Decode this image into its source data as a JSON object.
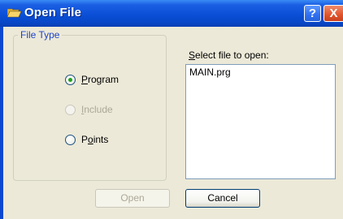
{
  "window": {
    "title": "Open File",
    "help_glyph": "?",
    "close_glyph": "X",
    "title_icon": "open-folder-icon",
    "colors": {
      "titlebar": "#0a4fd6",
      "face": "#ece9d8",
      "accent_text": "#1f44c8"
    }
  },
  "file_type": {
    "group_label": "File Type",
    "options": [
      {
        "label": "Program",
        "selected": true,
        "enabled": true
      },
      {
        "label": "Include",
        "selected": false,
        "enabled": false
      },
      {
        "label": "Points",
        "selected": false,
        "enabled": true
      }
    ]
  },
  "file_list": {
    "label": "Select file to open:",
    "items": [
      "MAIN.prg"
    ]
  },
  "buttons": {
    "open": "Open",
    "cancel": "Cancel"
  }
}
